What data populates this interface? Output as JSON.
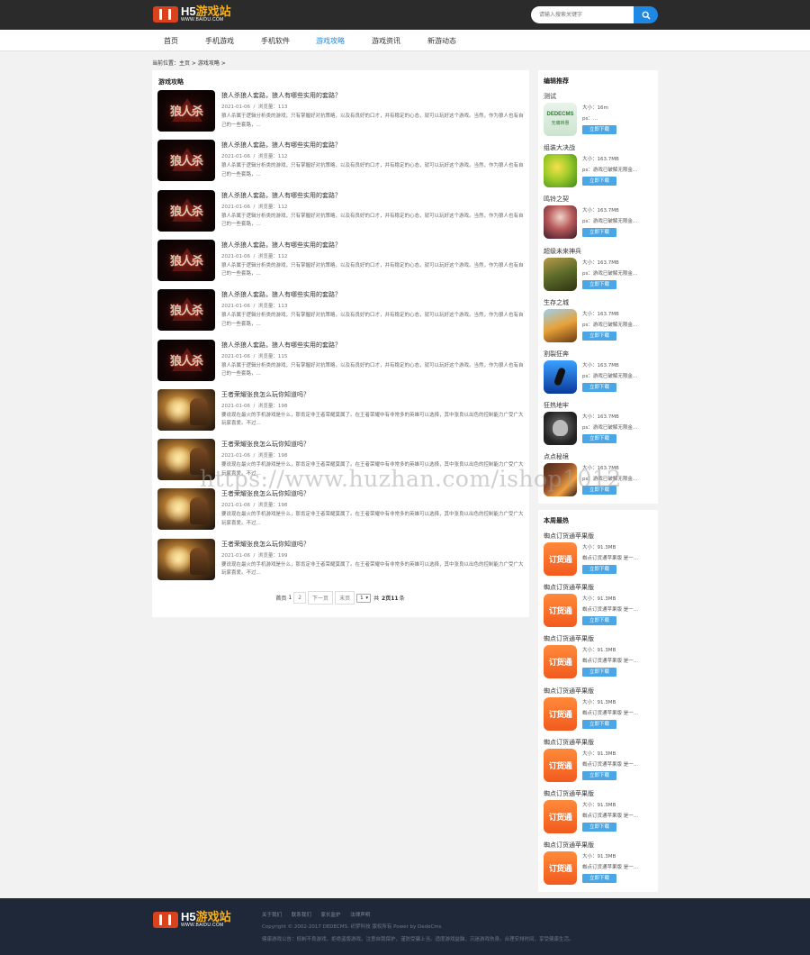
{
  "header": {
    "logo_main": "H5游戏站",
    "logo_main_h5": "H5",
    "logo_main_rest": "游戏站",
    "logo_sub": "WWW.BAIDU.COM",
    "search_placeholder": "请输入搜索关键字"
  },
  "nav": [
    "首页",
    "手机游戏",
    "手机软件",
    "游戏攻略",
    "游戏资讯",
    "新游动态"
  ],
  "nav_active": "游戏攻略",
  "breadcrumb": "当前位置：主页 > 游戏攻略 >",
  "main": {
    "section_title": "游戏攻略",
    "articles": [
      {
        "title": "狼人杀狼人套路，狼人有哪些实用的套路？",
        "date": "2021-01-06",
        "sep": "/",
        "views": "浏览量：113",
        "desc": "狼人杀属于逻辑分析类的游戏，只有掌握好对抗策略，以及有良好的口才，并有稳定的心态，就可以玩好这个游戏。当然，作为狼人也有自己的一些套路，...",
        "thumb": "狼人杀"
      },
      {
        "title": "狼人杀狼人套路，狼人有哪些实用的套路？",
        "date": "2021-01-06",
        "sep": "/",
        "views": "浏览量：112",
        "desc": "狼人杀属于逻辑分析类的游戏，只有掌握好对抗策略，以及有良好的口才，并有稳定的心态，就可以玩好这个游戏。当然，作为狼人也有自己的一些套路，...",
        "thumb": "狼人杀"
      },
      {
        "title": "狼人杀狼人套路，狼人有哪些实用的套路？",
        "date": "2021-01-06",
        "sep": "/",
        "views": "浏览量：112",
        "desc": "狼人杀属于逻辑分析类的游戏，只有掌握好对抗策略，以及有良好的口才，并有稳定的心态，就可以玩好这个游戏。当然，作为狼人也有自己的一些套路，...",
        "thumb": "狼人杀"
      },
      {
        "title": "狼人杀狼人套路，狼人有哪些实用的套路？",
        "date": "2021-01-06",
        "sep": "/",
        "views": "浏览量：112",
        "desc": "狼人杀属于逻辑分析类的游戏，只有掌握好对抗策略，以及有良好的口才，并有稳定的心态，就可以玩好这个游戏。当然，作为狼人也有自己的一些套路，...",
        "thumb": "狼人杀"
      },
      {
        "title": "狼人杀狼人套路，狼人有哪些实用的套路？",
        "date": "2021-01-06",
        "sep": "/",
        "views": "浏览量：113",
        "desc": "狼人杀属于逻辑分析类的游戏，只有掌握好对抗策略，以及有良好的口才，并有稳定的心态，就可以玩好这个游戏。当然，作为狼人也有自己的一些套路，...",
        "thumb": "狼人杀"
      },
      {
        "title": "狼人杀狼人套路，狼人有哪些实用的套路？",
        "date": "2021-01-06",
        "sep": "/",
        "views": "浏览量：115",
        "desc": "狼人杀属于逻辑分析类的游戏，只有掌握好对抗策略，以及有良好的口才，并有稳定的心态，就可以玩好这个游戏。当然，作为狼人也有自己的一些套路，...",
        "thumb": "狼人杀"
      },
      {
        "title": "王者荣耀张良怎么玩你知道吗？",
        "date": "2021-01-06",
        "sep": "/",
        "views": "浏览量：198",
        "desc": "要说现在最火的手机游戏是什么，那肯定非王者荣耀莫属了。在王者荣耀中有非常多的英雄可以选择，其中张良以出色的控制能力广受广大玩家喜爱。不过...",
        "thumb": ""
      },
      {
        "title": "王者荣耀张良怎么玩你知道吗？",
        "date": "2021-01-06",
        "sep": "/",
        "views": "浏览量：198",
        "desc": "要说现在最火的手机游戏是什么，那肯定非王者荣耀莫属了。在王者荣耀中有非常多的英雄可以选择，其中张良以出色的控制能力广受广大玩家喜爱。不过...",
        "thumb": ""
      },
      {
        "title": "王者荣耀张良怎么玩你知道吗？",
        "date": "2021-01-06",
        "sep": "/",
        "views": "浏览量：198",
        "desc": "要说现在最火的手机游戏是什么，那肯定非王者荣耀莫属了。在王者荣耀中有非常多的英雄可以选择，其中张良以出色的控制能力广受广大玩家喜爱。不过...",
        "thumb": ""
      },
      {
        "title": "王者荣耀张良怎么玩你知道吗？",
        "date": "2021-01-06",
        "sep": "/",
        "views": "浏览量：199",
        "desc": "要说现在最火的手机游戏是什么，那肯定非王者荣耀莫属了。在王者荣耀中有非常多的英雄可以选择，其中张良以出色的控制能力广受广大玩家喜爱。不过...",
        "thumb": ""
      }
    ],
    "pagination": {
      "first": "首页",
      "current": "1",
      "page2": "2",
      "next": "下一页",
      "last": "末页",
      "select_value": "1",
      "total_prefix": "共",
      "total_pages": "2",
      "total_mid": "页",
      "total_records": "11",
      "total_suffix": "条"
    }
  },
  "sidebar_editor": {
    "title": "编辑推荐",
    "apps": [
      {
        "name": "测试",
        "size": "大小：16m",
        "ps": "ps：...",
        "button": "立即下载",
        "icon": "dedecms-icon",
        "icon_text1": "DEDECMS",
        "icon_text2": "无痛转惠"
      },
      {
        "name": "组装大决战",
        "size": "大小：163.7MB",
        "ps": "ps：游戏已破解无限金...",
        "button": "立即下载",
        "icon": "game-icon-frog"
      },
      {
        "name": "鸣铃之契",
        "size": "大小：163.7MB",
        "ps": "ps：游戏已破解无限金...",
        "button": "立即下载",
        "icon": "game-icon-girl"
      },
      {
        "name": "超级未来神兵",
        "size": "大小：163.7MB",
        "ps": "ps：游戏已破解无限金...",
        "button": "立即下载",
        "icon": "game-icon-soldier"
      },
      {
        "name": "生存之城",
        "size": "大小：163.7MB",
        "ps": "ps：游戏已破解无限金...",
        "button": "立即下载",
        "icon": "game-icon-city"
      },
      {
        "name": "割裂狂奔",
        "size": "大小：163.7MB",
        "ps": "ps：游戏已破解无限金...",
        "button": "立即下载",
        "icon": "game-icon-runner"
      },
      {
        "name": "狂热地牢",
        "size": "大小：163.7MB",
        "ps": "ps：游戏已破解无限金...",
        "button": "立即下载",
        "icon": "game-icon-skull"
      },
      {
        "name": "点点秘境",
        "size": "大小：163.7MB",
        "ps": "ps：游戏已破解无限金...",
        "button": "立即下载",
        "icon": "game-icon-hero"
      }
    ]
  },
  "sidebar_hot": {
    "title": "本周最热",
    "apps": [
      {
        "name": "蜘点订货通苹果版",
        "size": "大小：91.3MB",
        "ps": "蜘点订货通苹果版 是一...",
        "button": "立即下载",
        "icon_text": "订货通"
      },
      {
        "name": "蜘点订货通苹果版",
        "size": "大小：91.3MB",
        "ps": "蜘点订货通苹果版 是一...",
        "button": "立即下载",
        "icon_text": "订货通"
      },
      {
        "name": "蜘点订货通苹果版",
        "size": "大小：91.3MB",
        "ps": "蜘点订货通苹果版 是一...",
        "button": "立即下载",
        "icon_text": "订货通"
      },
      {
        "name": "蜘点订货通苹果版",
        "size": "大小：91.3MB",
        "ps": "蜘点订货通苹果版 是一...",
        "button": "立即下载",
        "icon_text": "订货通"
      },
      {
        "name": "蜘点订货通苹果版",
        "size": "大小：91.3MB",
        "ps": "蜘点订货通苹果版 是一...",
        "button": "立即下载",
        "icon_text": "订货通"
      },
      {
        "name": "蜘点订货通苹果版",
        "size": "大小：91.3MB",
        "ps": "蜘点订货通苹果版 是一...",
        "button": "立即下载",
        "icon_text": "订货通"
      },
      {
        "name": "蜘点订货通苹果版",
        "size": "大小：91.3MB",
        "ps": "蜘点订货通苹果版 是一...",
        "button": "立即下载",
        "icon_text": "订货通"
      }
    ]
  },
  "footer": {
    "links": [
      "关于我们",
      "联系我们",
      "家长监护",
      "法律声明"
    ],
    "copyright": "Copyright © 2002-2017 DEDECMS. 织梦科技 版权所有 Power by DedeCms",
    "note": "健康游戏公告：抵制不良游戏，拒绝盗版游戏。注意自我保护，谨防受骗上当。适度游戏益脑，沉迷游戏伤身。合理安排时间，享受健康生活。"
  },
  "watermark": "https://www.huzhan.com/ishop1012",
  "colors": {
    "accent": "#2a87d6",
    "topbar": "#2b2b2b",
    "footer": "#1f2838",
    "download": "#4aa6e5",
    "logo": "#d8421c"
  }
}
